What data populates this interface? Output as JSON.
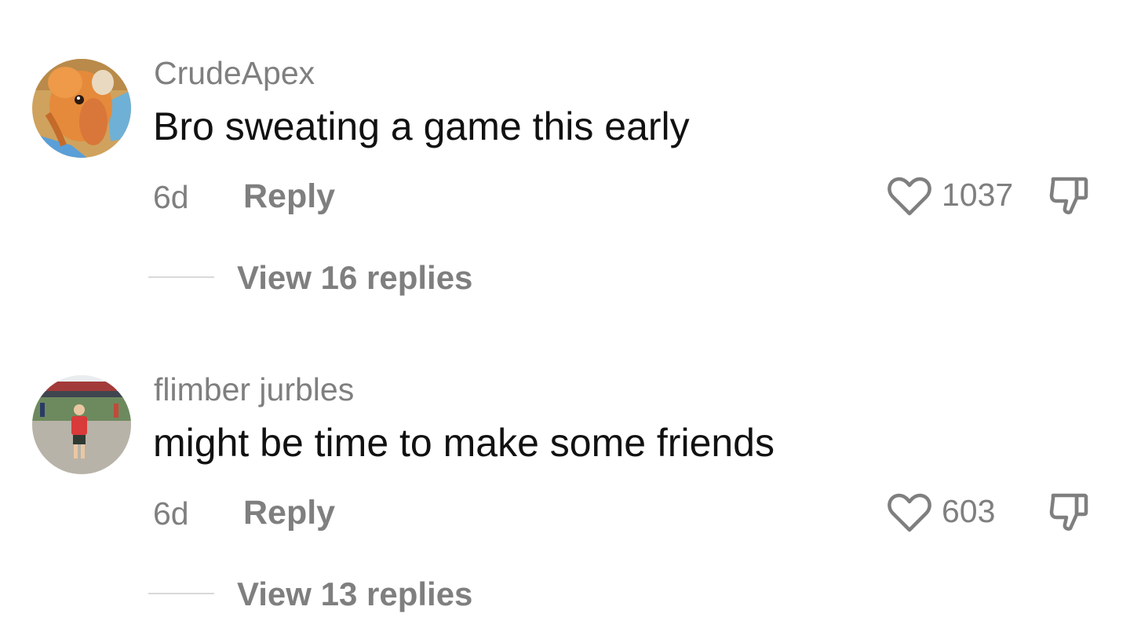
{
  "comments": [
    {
      "username": "CrudeApex",
      "text": "Bro sweating a game this early",
      "time": "6d",
      "reply_label": "Reply",
      "likes": "1037",
      "view_replies": "View 16 replies"
    },
    {
      "username": "flimber jurbles",
      "text": "might be time to make some friends",
      "time": "6d",
      "reply_label": "Reply",
      "likes": "603",
      "view_replies": "View 13 replies"
    }
  ],
  "icons": {
    "like": "heart-outline-icon",
    "dislike": "thumbs-down-icon"
  },
  "colors": {
    "secondary_text": "#7f7f7f",
    "primary_text": "#111111",
    "divider": "#d9d9d9"
  }
}
